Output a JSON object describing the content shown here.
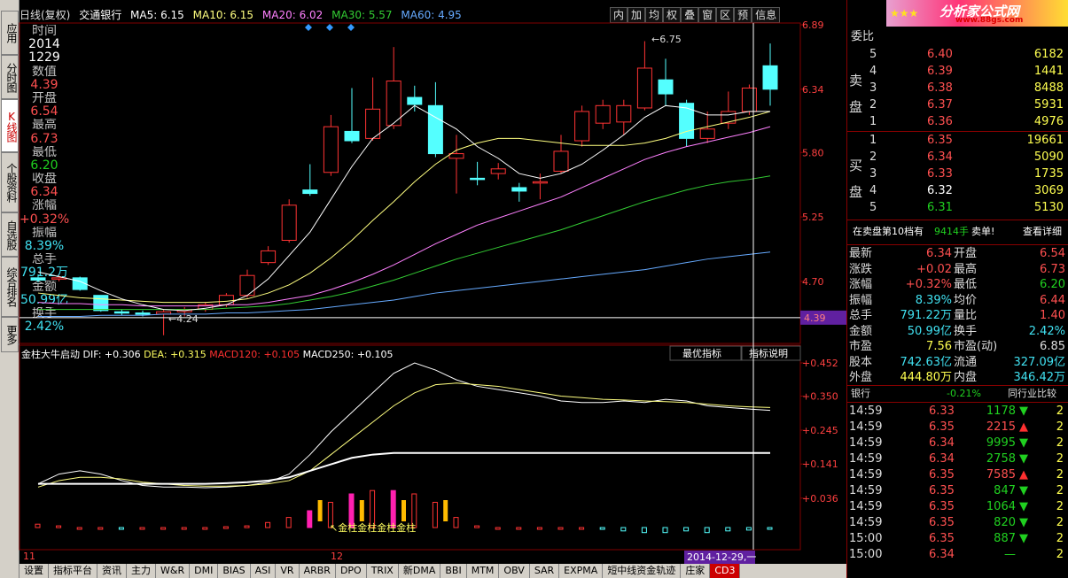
{
  "header": {
    "period": "日线(复权)",
    "stock_name": "交通银行",
    "ma5": "MA5: 6.15",
    "ma10": "MA10: 6.15",
    "ma20": "MA20: 6.02",
    "ma30": "MA30: 5.57",
    "ma60": "MA60: 4.95"
  },
  "toolbar": [
    "内",
    "加",
    "均",
    "权",
    "叠",
    "窗",
    "区",
    "预",
    "信息"
  ],
  "left_tabs": [
    "应用",
    "分时图",
    "K线图",
    "个股资料",
    "自选股",
    "综合排名",
    "更多"
  ],
  "quote": {
    "time_label": "时间",
    "date_year": "2014",
    "date_md": "1229",
    "value_label": "数值",
    "value": "4.39",
    "open_label": "开盘",
    "open": "6.54",
    "high_label": "最高",
    "high": "6.73",
    "low_label": "最低",
    "low": "6.20",
    "close_label": "收盘",
    "close": "6.34",
    "change_label": "涨幅",
    "change": "+0.32%",
    "amp_label": "振幅",
    "amp": "8.39%",
    "vol_label": "总手",
    "vol": "791.2万",
    "amount_label": "金额",
    "amount": "50.99亿",
    "turnover_label": "换手",
    "turnover": "2.42%"
  },
  "price_axis": [
    "6.89",
    "6.34",
    "5.80",
    "5.25",
    "4.70",
    "4.39"
  ],
  "annotations": {
    "high_mark": "6.75",
    "low_mark": "4.24",
    "cursor_price": "4.39",
    "gold_label": "金柱金柱金柱金柱",
    "date_cursor": "2014-12-29,一"
  },
  "indicator": {
    "name": "金柱大牛启动",
    "dif": "DIF: +0.306",
    "dea": "DEA: +0.315",
    "macd120": "MACD120: +0.105",
    "macd250": "MACD250: +0.105",
    "btn_best": "最优指标",
    "btn_help": "指标说明"
  },
  "indicator_axis": [
    "+0.452",
    "+0.350",
    "+0.245",
    "+0.141",
    "+0.036"
  ],
  "x_axis": [
    "11",
    "12"
  ],
  "order_book": {
    "header": "委比",
    "sell_label": "卖盘",
    "buy_label": "买盘",
    "sell": [
      {
        "lv": "5",
        "p": "6.40",
        "v": "6182"
      },
      {
        "lv": "4",
        "p": "6.39",
        "v": "1441"
      },
      {
        "lv": "3",
        "p": "6.38",
        "v": "8488"
      },
      {
        "lv": "2",
        "p": "6.37",
        "v": "5931"
      },
      {
        "lv": "1",
        "p": "6.36",
        "v": "4976"
      }
    ],
    "buy": [
      {
        "lv": "1",
        "p": "6.35",
        "v": "19661"
      },
      {
        "lv": "2",
        "p": "6.34",
        "v": "5090"
      },
      {
        "lv": "3",
        "p": "6.33",
        "v": "1735"
      },
      {
        "lv": "4",
        "p": "6.32",
        "v": "3069"
      },
      {
        "lv": "5",
        "p": "6.31",
        "v": "5130"
      }
    ],
    "note_a": "在卖盘第10档有",
    "note_qty": "9414手",
    "note_b": "卖单!",
    "note_link": "查看详细"
  },
  "stats": [
    {
      "l1": "最新",
      "v1": "6.34",
      "l2": "开盘",
      "v2": "6.54"
    },
    {
      "l1": "涨跌",
      "v1": "+0.02",
      "l2": "最高",
      "v2": "6.73"
    },
    {
      "l1": "涨幅",
      "v1": "+0.32%",
      "l2": "最低",
      "v2": "6.20"
    },
    {
      "l1": "振幅",
      "v1": "8.39%",
      "l2": "均价",
      "v2": "6.44"
    },
    {
      "l1": "总手",
      "v1": "791.22万",
      "l2": "量比",
      "v2": "1.40"
    },
    {
      "l1": "金额",
      "v1": "50.99亿",
      "l2": "换手",
      "v2": "2.42%"
    },
    {
      "l1": "市盈",
      "v1": "7.56",
      "l2": "市盈(动)",
      "v2": "6.85"
    },
    {
      "l1": "股本",
      "v1": "742.63亿",
      "l2": "流通",
      "v2": "327.09亿"
    },
    {
      "l1": "外盘",
      "v1": "444.80万",
      "l2": "内盘",
      "v2": "346.42万"
    }
  ],
  "industry": {
    "name": "银行",
    "change": "-0.21%",
    "btn": "同行业比较"
  },
  "trades": [
    {
      "t": "14:59",
      "p": "6.33",
      "v": "1178",
      "d": "down"
    },
    {
      "t": "14:59",
      "p": "6.35",
      "v": "2215",
      "d": "up"
    },
    {
      "t": "14:59",
      "p": "6.34",
      "v": "9995",
      "d": "down"
    },
    {
      "t": "14:59",
      "p": "6.34",
      "v": "2758",
      "d": "down"
    },
    {
      "t": "14:59",
      "p": "6.35",
      "v": "7585",
      "d": "up"
    },
    {
      "t": "14:59",
      "p": "6.35",
      "v": "847",
      "d": "down"
    },
    {
      "t": "14:59",
      "p": "6.35",
      "v": "1064",
      "d": "down"
    },
    {
      "t": "14:59",
      "p": "6.35",
      "v": "820",
      "d": "down"
    },
    {
      "t": "15:00",
      "p": "6.35",
      "v": "887",
      "d": "down"
    },
    {
      "t": "15:00",
      "p": "6.34",
      "v": "—",
      "d": "none"
    }
  ],
  "logo_text": "分析家公式网",
  "logo_url": "www.88gs.com",
  "bottom_tabs": [
    "设置",
    "指标平台",
    "资讯",
    "主力",
    "W&R",
    "DMI",
    "BIAS",
    "ASI",
    "VR",
    "ARBR",
    "DPO",
    "TRIX",
    "新DMA",
    "BBI",
    "MTM",
    "OBV",
    "SAR",
    "EXPMA",
    "短中线资金轨迹",
    "庄家",
    "CD3"
  ],
  "colors": {
    "up": "#ff3333",
    "down": "#54ffff",
    "ma5": "#ffffff",
    "ma10": "#ffff80",
    "ma20": "#ff80ff",
    "ma30": "#33cc33",
    "ma60": "#66aaff",
    "gold": "#ffbb00",
    "magenta": "#ff20b0"
  }
}
